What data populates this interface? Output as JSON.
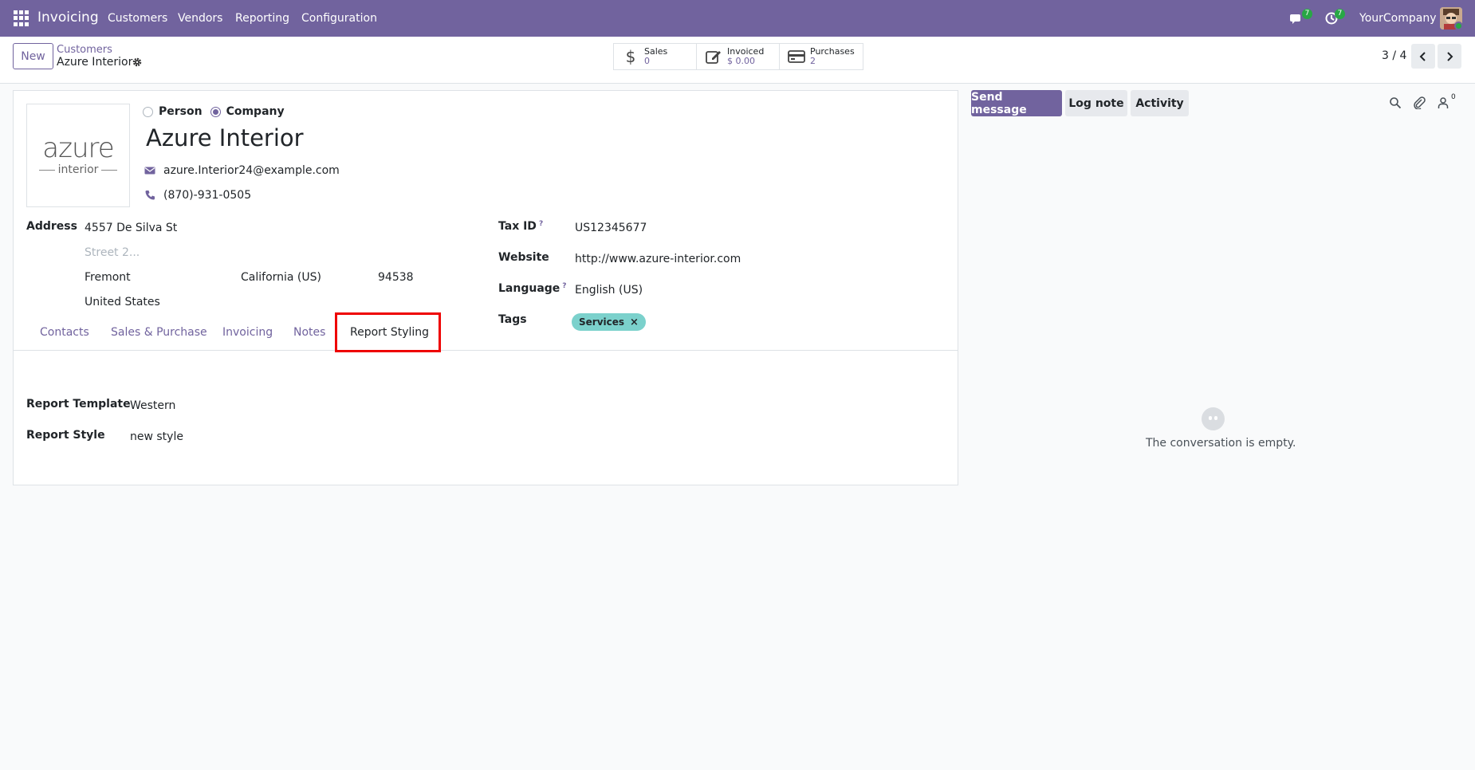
{
  "navbar": {
    "app_name": "Invoicing",
    "menu": [
      "Customers",
      "Vendors",
      "Reporting",
      "Configuration"
    ],
    "messages_badge": "7",
    "activities_badge": "7",
    "company": "YourCompany"
  },
  "control_panel": {
    "new_label": "New",
    "breadcrumb_parent": "Customers",
    "breadcrumb_current": "Azure Interior",
    "smart_buttons": [
      {
        "label": "Sales",
        "value": "0",
        "icon": "dollar-icon"
      },
      {
        "label": "Invoiced",
        "value": "$ 0.00",
        "icon": "edit-icon"
      },
      {
        "label": "Purchases",
        "value": "2",
        "icon": "credit-card-icon"
      }
    ],
    "pager": "3 / 4"
  },
  "form": {
    "logo": {
      "main": "azure",
      "sub": "interior"
    },
    "type_person": "Person",
    "type_company": "Company",
    "selected_type": "Company",
    "name": "Azure Interior",
    "email": "azure.Interior24@example.com",
    "phone": "(870)-931-0505",
    "address_label": "Address",
    "street": "4557 De Silva St",
    "street2_placeholder": "Street 2...",
    "city": "Fremont",
    "state": "California (US)",
    "zip": "94538",
    "country": "United States",
    "tax_id_label": "Tax ID",
    "tax_id": "US12345677",
    "website_label": "Website",
    "website": "http://www.azure-interior.com",
    "language_label": "Language",
    "language": "English (US)",
    "tags_label": "Tags",
    "tags": [
      "Services"
    ],
    "help_mark": "?"
  },
  "tabs": [
    "Contacts",
    "Sales & Purchase",
    "Invoicing",
    "Notes",
    "Report Styling"
  ],
  "active_tab": "Report Styling",
  "report_styling": {
    "template_label": "Report Template",
    "template_value": "Western",
    "style_label": "Report Style",
    "style_value": "new style"
  },
  "chatter": {
    "send_message": "Send message",
    "log_note": "Log note",
    "activity": "Activity",
    "follower_count": "0",
    "empty_text": "The conversation is empty."
  },
  "colors": {
    "brand": "#71639e",
    "tag": "#7bd1cc",
    "badge": "#28a745",
    "highlight": "#ee0000"
  }
}
